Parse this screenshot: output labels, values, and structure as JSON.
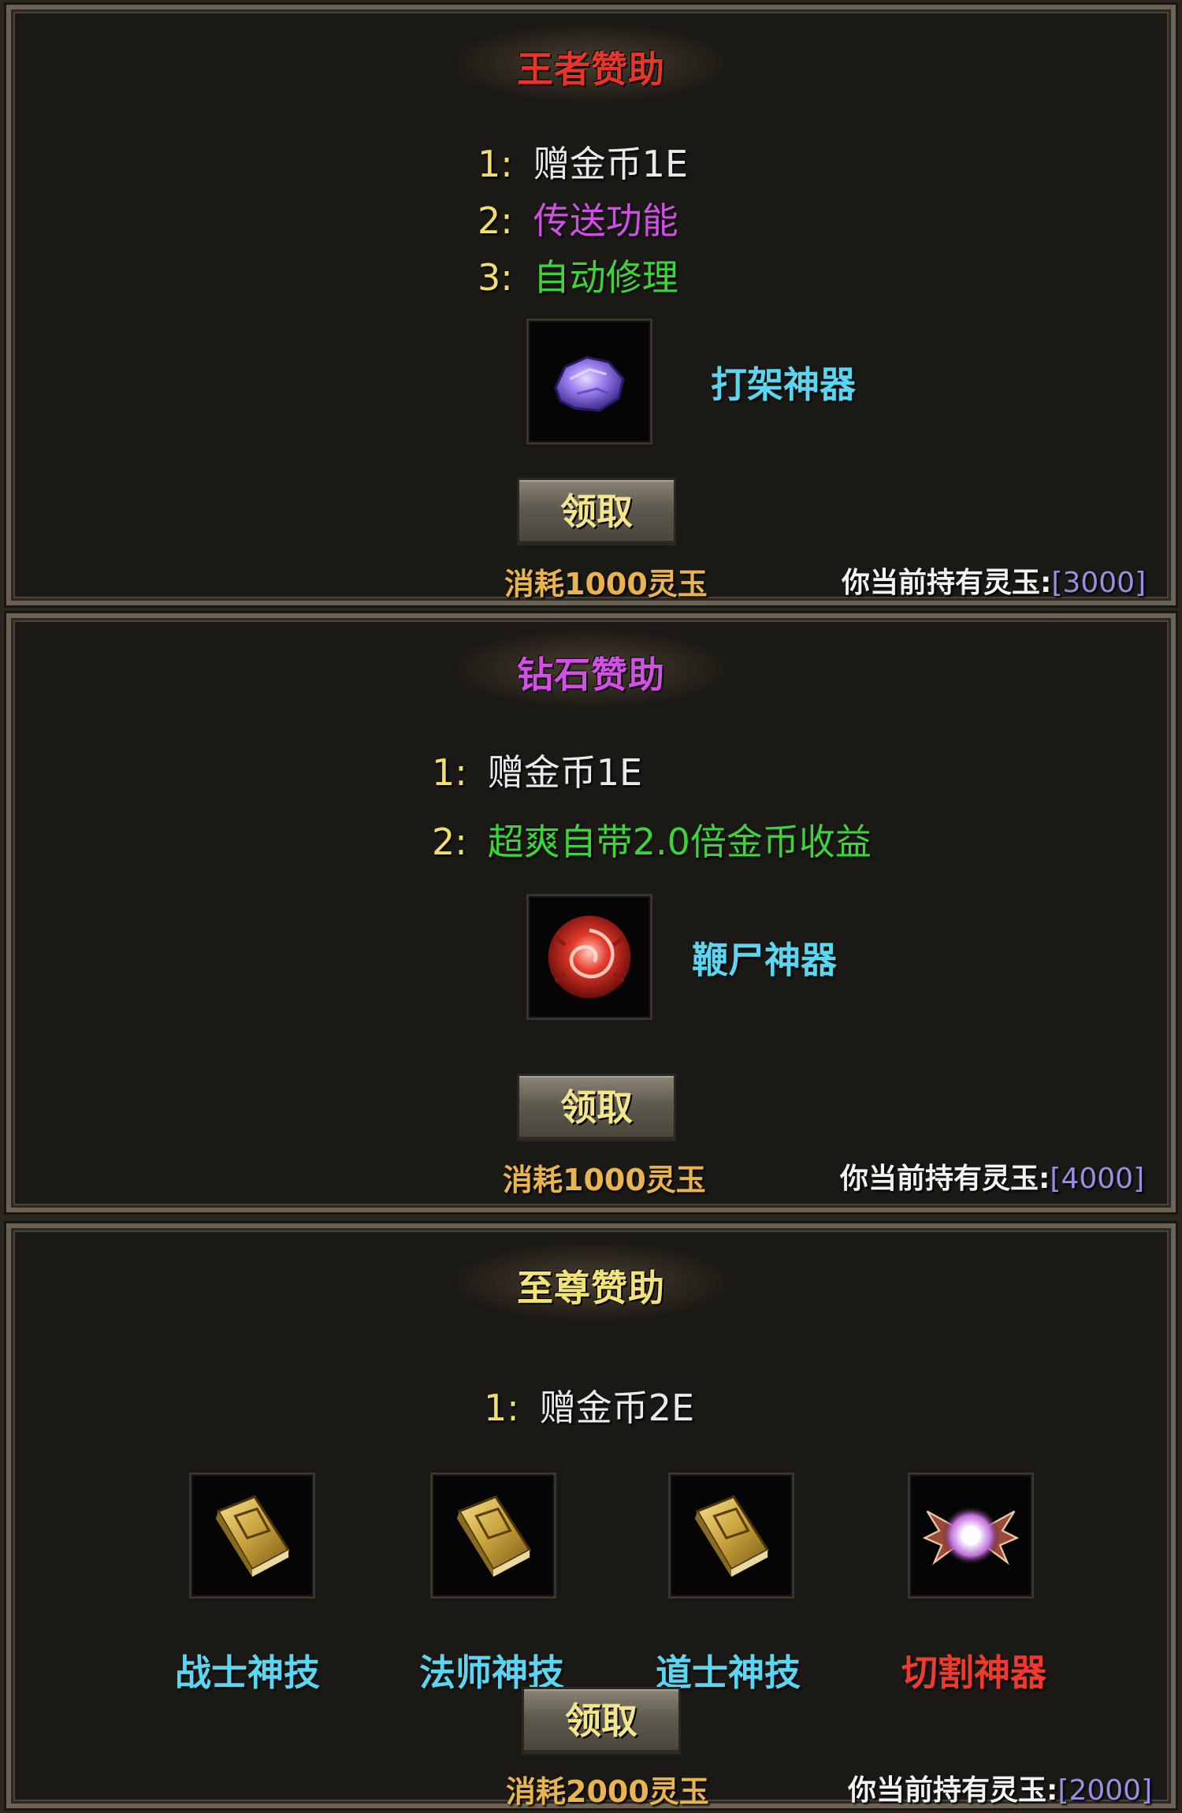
{
  "colors": {
    "title_king": "#e8352a",
    "title_diamond": "#d64ee8",
    "title_supreme": "#f2e27a",
    "reward_white": "#e9e9e9",
    "reward_magenta": "#d14fe6",
    "reward_green": "#3bd43b",
    "item_cyan": "#5ad6f2",
    "item_red": "#ef3a2c"
  },
  "panels": [
    {
      "title": "王者赞助",
      "rewards": [
        {
          "num": "1",
          "sep": ":",
          "text": "赠金币1E",
          "color": "white"
        },
        {
          "num": "2",
          "sep": ":",
          "text": "传送功能",
          "color": "magenta"
        },
        {
          "num": "3",
          "sep": ":",
          "text": "自动修理",
          "color": "green"
        }
      ],
      "items": [
        {
          "name": "打架神器",
          "icon": "purple-crystal-icon"
        }
      ],
      "claim_label": "领取",
      "cost": "消耗1000灵玉",
      "balance_label": "你当前持有灵玉:",
      "balance_value": "[3000]"
    },
    {
      "title": "钻石赞助",
      "rewards": [
        {
          "num": "1",
          "sep": ":",
          "text": "赠金币1E",
          "color": "white"
        },
        {
          "num": "2",
          "sep": ":",
          "text": "超爽自带2.0倍金币收益",
          "color": "green"
        }
      ],
      "items": [
        {
          "name": "鞭尸神器",
          "icon": "red-rose-gem-icon"
        }
      ],
      "claim_label": "领取",
      "cost": "消耗1000灵玉",
      "balance_label": "你当前持有灵玉:",
      "balance_value": "[4000]"
    },
    {
      "title": "至尊赞助",
      "rewards": [
        {
          "num": "1",
          "sep": ":",
          "text": "赠金币2E",
          "color": "white"
        }
      ],
      "items": [
        {
          "name": "战士神技",
          "icon": "skill-book-icon"
        },
        {
          "name": "法师神技",
          "icon": "skill-book-icon"
        },
        {
          "name": "道士神技",
          "icon": "skill-book-icon"
        },
        {
          "name": "切割神器",
          "icon": "winged-orb-icon"
        }
      ],
      "claim_label": "领取",
      "cost": "消耗2000灵玉",
      "balance_label": "你当前持有灵玉:",
      "balance_value": "[2000]"
    }
  ]
}
